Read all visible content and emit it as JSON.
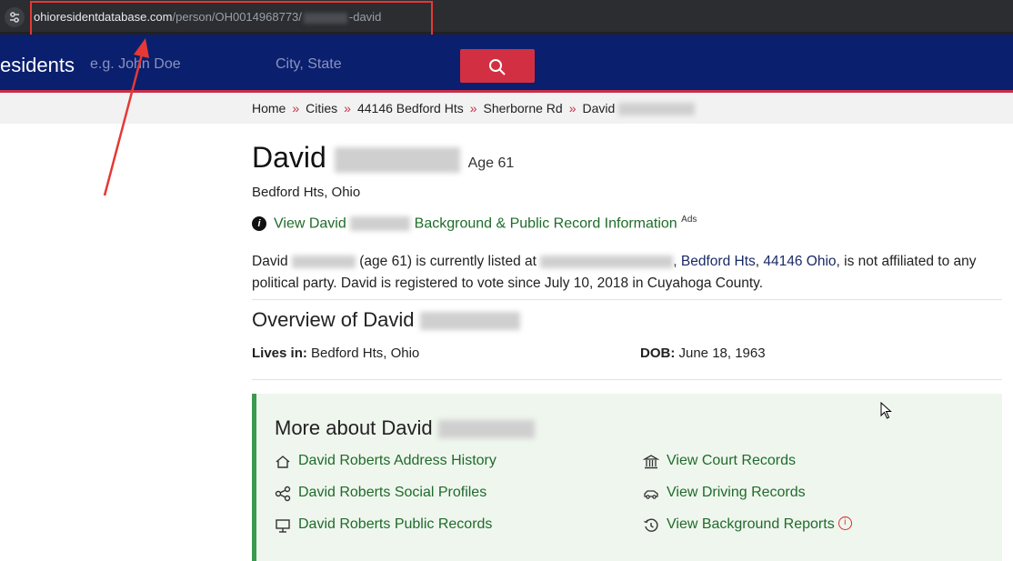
{
  "browser": {
    "url_domain": "ohioresidentdatabase.com",
    "url_path": "/person/OH0014968773/",
    "url_suffix": "-david"
  },
  "site": {
    "brand": "esidents",
    "name_placeholder": "e.g. John Doe",
    "city_placeholder": "City, State",
    "search_icon": "search-icon"
  },
  "breadcrumb": [
    "Home",
    "Cities",
    "44146 Bedford Hts",
    "Sherborne Rd",
    "David"
  ],
  "person": {
    "first_name": "David",
    "age_label": "Age 61",
    "location": "Bedford Hts, Ohio",
    "view_link_prefix": "View David",
    "view_link_suffix": "Background & Public Record Information",
    "ads_label": "Ads"
  },
  "bio": {
    "part1": "David",
    "part2": "(age 61) is currently listed at",
    "city_link": "Bedford Hts",
    "zip_link": "44146 Ohio",
    "part3": ", is not affiliated to any political party. David is registered to vote since July 10, 2018 in Cuyahoga County."
  },
  "overview": {
    "title": "Overview of David",
    "lives_label": "Lives in:",
    "lives_value": "Bedford Hts, Ohio",
    "dob_label": "DOB:",
    "dob_value": "June 18, 1963"
  },
  "more": {
    "title": "More about David",
    "links": [
      {
        "label": "David Roberts Address History",
        "icon": "home-icon"
      },
      {
        "label": "David Roberts Social Profiles",
        "icon": "share-icon"
      },
      {
        "label": "David Roberts Public Records",
        "icon": "records-icon"
      },
      {
        "label": "View Court Records",
        "icon": "courthouse-icon"
      },
      {
        "label": "View Driving Records",
        "icon": "car-icon"
      },
      {
        "label": "View Background Reports",
        "icon": "history-icon"
      }
    ]
  },
  "colors": {
    "header_bg": "#0a1f6e",
    "accent_red": "#d32f42",
    "link_green": "#1f6b2a",
    "annotation_red": "#e53935"
  }
}
